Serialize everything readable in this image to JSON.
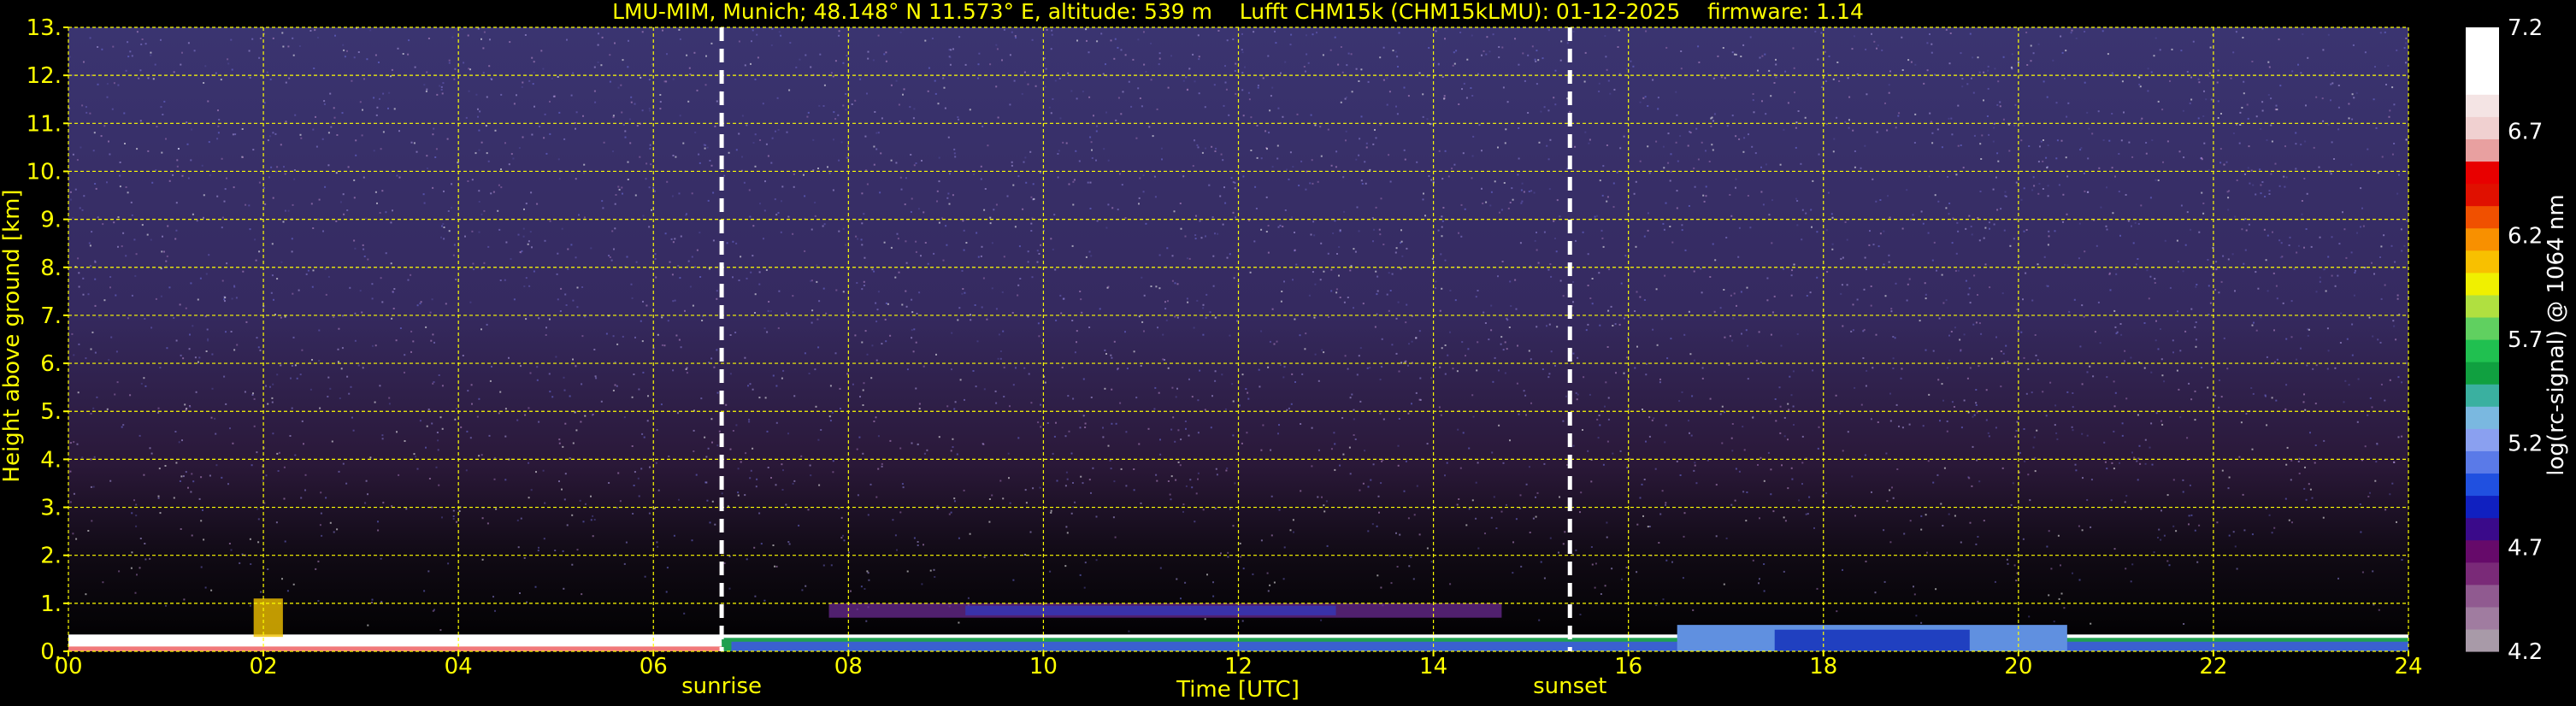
{
  "header": {
    "title": "LMU-MIM, Munich; 48.148° N 11.573° E, altitude: 539 m    Lufft CHM15k (CHM15kLMU): 01-12-2025    firmware: 1.14"
  },
  "colors": {
    "background": "#000000",
    "text": "#ffff00",
    "grid": "#ffff00",
    "marker_line": "#ffffff",
    "colorbar_text": "#ffffff"
  },
  "chart_data": {
    "type": "heatmap",
    "title": "LMU-MIM, Munich; 48.148° N 11.573° E, altitude: 539 m    Lufft CHM15k (CHM15kLMU): 01-12-2025    firmware: 1.14",
    "xlabel": "Time [UTC]",
    "ylabel": "Height above ground [km]",
    "xlim": [
      0,
      24
    ],
    "ylim": [
      0,
      13
    ],
    "x_ticks": [
      0,
      2,
      4,
      6,
      8,
      10,
      12,
      14,
      16,
      18,
      20,
      22,
      24
    ],
    "x_tick_labels": [
      "00",
      "02",
      "04",
      "06",
      "08",
      "10",
      "12",
      "14",
      "16",
      "18",
      "20",
      "22",
      "24"
    ],
    "y_ticks": [
      0,
      1,
      2,
      3,
      4,
      5,
      6,
      7,
      8,
      9,
      10,
      11,
      12,
      13
    ],
    "y_tick_labels": [
      "0.",
      "1.",
      "2.",
      "3.",
      "4.",
      "5.",
      "6.",
      "7.",
      "8.",
      "9.",
      "10.",
      "11.",
      "12.",
      "13."
    ],
    "grid": true,
    "markers": [
      {
        "label": "sunrise",
        "x": 6.7
      },
      {
        "label": "sunset",
        "x": 15.4
      }
    ],
    "colorbar": {
      "label": "log(rc-signal) @ 1064 nm",
      "range": [
        4.2,
        7.2
      ],
      "ticks": [
        4.2,
        4.7,
        5.2,
        5.7,
        6.2,
        6.7,
        7.2
      ],
      "tick_labels": [
        "4.2",
        "4.7",
        "5.2",
        "5.7",
        "6.2",
        "6.7",
        "7.2"
      ],
      "colors": [
        "#a89aa8",
        "#a07ca0",
        "#905a90",
        "#7a2a78",
        "#660a6a",
        "#3a0a8a",
        "#1020c0",
        "#2050e0",
        "#5a7ae8",
        "#8aa0f0",
        "#7ab8e0",
        "#3ab0a0",
        "#10a040",
        "#20c050",
        "#60d060",
        "#b0e040",
        "#f0f000",
        "#f8c000",
        "#f89000",
        "#f05000",
        "#e01000",
        "#e80000",
        "#e8a0a0",
        "#f0d0d0",
        "#f4e4e4",
        "#ffffff",
        "#ffffff",
        "#ffffff"
      ]
    }
  }
}
